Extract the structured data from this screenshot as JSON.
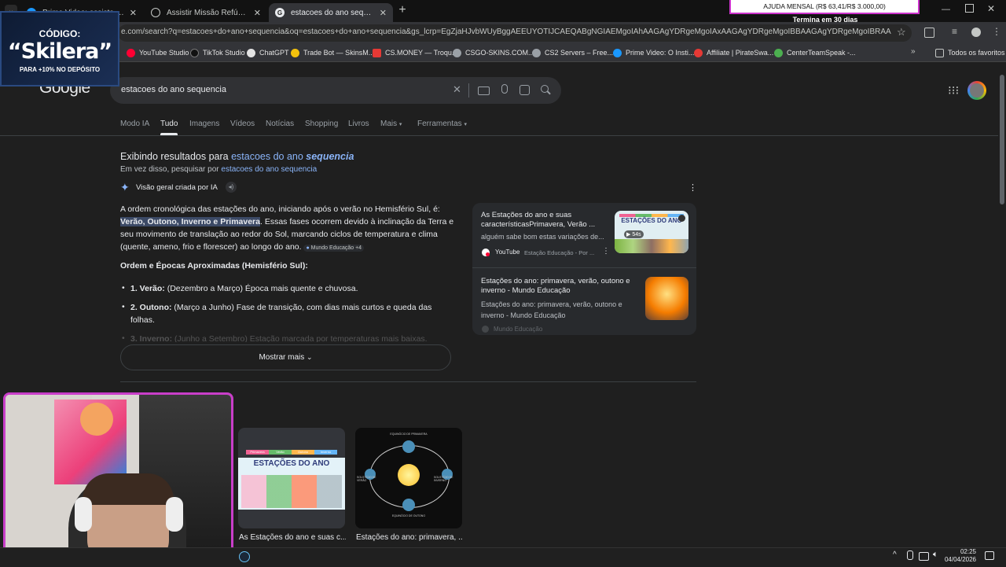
{
  "tabs": [
    {
      "label": "Prime Video: assista a filmes, sé",
      "icon_color": "#1a98ff",
      "active": false
    },
    {
      "label": "Assistir Missão Refúgio Online",
      "icon_color": "#e8eaed",
      "active": false
    },
    {
      "label": "estacoes do ano sequencia - Pe",
      "icon_color": "#e8eaed",
      "active": true
    }
  ],
  "promo": {
    "title": "AJUDA MENSAL (R$ 63,41/R$ 3.000,00)",
    "sub": "Termina em 30 dias"
  },
  "overlay": {
    "label": "CÓDIGO:",
    "code": "“Skilera”",
    "sub": "PARA +10% NO DEPÓSITO"
  },
  "address": {
    "url": "e.com/search?q=estacoes+do+ano+sequencia&oq=estacoes+do+ano+sequencia&gs_lcrp=EgZjaHJvbWUyBggAEEUYOTIJCAEQABgNGIAEMgoIAhAAGAgYDRgeMgoIAxAAGAgYDRgeMgoIBBAAGAgYDRgeMgoIBRAAGAgYDRgeMgoIBhAAGK"
  },
  "bookmarks": [
    {
      "label": "YouTube Studio",
      "color": "#ff0033"
    },
    {
      "label": "TikTok Studio",
      "color": "#111111"
    },
    {
      "label": "ChatGPT",
      "color": "#e3e3e3"
    },
    {
      "label": "Trade Bot — SkinsM...",
      "color": "#f4c20d"
    },
    {
      "label": "CS.MONEY — Troqu...",
      "color": "#e53935"
    },
    {
      "label": "CSGO-SKINS.COM...",
      "color": "#9aa0a6"
    },
    {
      "label": "CS2 Servers – Free...",
      "color": "#9aa0a6"
    },
    {
      "label": "Prime Video: O Insti...",
      "color": "#1a98ff"
    },
    {
      "label": "Affiliate | PirateSwa...",
      "color": "#e53935"
    },
    {
      "label": "CenterTeamSpeak -...",
      "color": "#4caf50"
    }
  ],
  "bookmarks_other": "Todos os favoritos",
  "google": {
    "logo": "Google",
    "query": "estacoes do ano sequencia",
    "nav": [
      "Modo IA",
      "Tudo",
      "Imagens",
      "Vídeos",
      "Notícias",
      "Shopping",
      "Livros",
      "Mais",
      "Ferramentas"
    ],
    "showing_prefix": "Exibindo resultados para ",
    "showing_plain": "estacoes do ano ",
    "showing_em": "sequencia",
    "instead_prefix": "Em vez disso, pesquisar por ",
    "instead_link": "estacoes do ano sequencia",
    "ai_label": "Visão geral criada por IA",
    "ai_p1_pre": "A ordem cronológica das estações do ano, iniciando após o verão no Hemisfério Sul, é:",
    "ai_p1_highlight": "Verão, Outono, Inverno e Primavera",
    "ai_p1_post": ". Essas fases ocorrem devido à inclinação da Terra e seu movimento de translação ao redor do Sol, marcando ciclos de temperatura e clima (quente, ameno, frio e florescer) ao longo do ano.",
    "ai_source_chip": "Mundo Educação +4",
    "ai_heading": "Ordem e Épocas Aproximadas (Hemisfério Sul):",
    "ai_list": [
      {
        "bold": "1. Verão:",
        "text": " (Dezembro a Março) Época mais quente e chuvosa."
      },
      {
        "bold": "2. Outono:",
        "text": " (Março a Junho) Fase de transição, com dias mais curtos e queda das folhas."
      },
      {
        "bold": "3. Inverno:",
        "text": " (Junho a Setembro) Estação marcada por temperaturas mais baixas."
      }
    ],
    "show_more": "Mostrar mais",
    "sources": [
      {
        "title": "As Estações do ano e suas característicasPrimavera, Verão ...",
        "snippet": "alguém sabe bom estas variações de...",
        "site": "YouTube",
        "site_sub": "Estação Educação - Por ...",
        "duration": "54s",
        "thumb_text": "ESTAÇÕES DO ANO"
      },
      {
        "title": "Estações do ano: primavera, verão, outono e inverno - Mundo Educação",
        "snippet": "Estações do ano: primavera, verão, outono e inverno - Mundo Educação",
        "site": "Mundo Educação"
      }
    ],
    "image_cards": [
      {
        "caption": "As Estações do ano e suas c...",
        "thumb_text": "ESTAÇÕES DO ANO",
        "tags": [
          "Primavera",
          "Verão",
          "Outono",
          "Inverno"
        ]
      },
      {
        "caption": "Estações do ano: primavera, ...",
        "tags": [
          "EQUINÓCIO DE PRIMAVERA",
          "SOLSTÍCIO DE VERÃO",
          "SOLSTÍCIO DE INVERNO",
          "EQUINÓCIO DE OUTONO"
        ]
      }
    ]
  },
  "taskbar": {
    "time": "02:25",
    "date": "04/04/2026"
  },
  "colors": {
    "bg": "#1f1f1f",
    "link": "#8ab4f8",
    "highlight": "#3c4a66",
    "overlay_bg": "#13233f",
    "promo_border": "#cc33cc"
  }
}
